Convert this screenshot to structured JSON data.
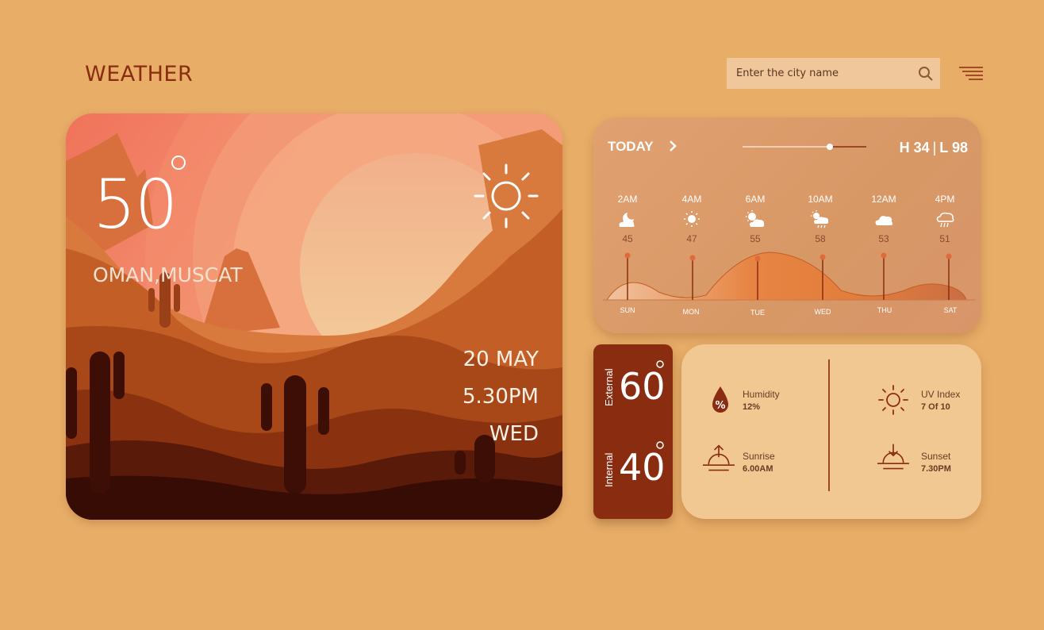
{
  "header": {
    "title": "WEATHER",
    "search_placeholder": "Enter the city name",
    "search_icon": "search-icon",
    "menu_icon": "menu-icon"
  },
  "current": {
    "temperature": "50",
    "location": "OMAN,MUSCAT",
    "date": "20 MAY",
    "time": "5.30PM",
    "day": "WED",
    "condition_icon": "sun-icon"
  },
  "forecast": {
    "today_label": "TODAY",
    "high_label": "H 34",
    "low_label": "L 98",
    "hours": [
      {
        "time": "2AM",
        "temp": "45",
        "icon": "moon-cloud-icon"
      },
      {
        "time": "4AM",
        "temp": "47",
        "icon": "sun-icon"
      },
      {
        "time": "6AM",
        "temp": "55",
        "icon": "partly-cloudy-icon"
      },
      {
        "time": "10AM",
        "temp": "58",
        "icon": "sun-rain-cloud-icon"
      },
      {
        "time": "12AM",
        "temp": "53",
        "icon": "cloud-icon"
      },
      {
        "time": "4PM",
        "temp": "51",
        "icon": "rain-cloud-icon"
      }
    ],
    "days": [
      "SUN",
      "MON",
      "TUE",
      "WED",
      "THU",
      "SAT"
    ]
  },
  "temps": {
    "external_label": "External",
    "external_value": "60",
    "internal_label": "Internal",
    "internal_value": "40"
  },
  "details": {
    "humidity_label": "Humidity",
    "humidity_value": "12%",
    "uv_label": "UV Index",
    "uv_value": "7 Of 10",
    "sunrise_label": "Sunrise",
    "sunrise_value": "6.00AM",
    "sunset_label": "Sunset",
    "sunset_value": "7.30PM"
  },
  "colors": {
    "background": "#e8ae68",
    "accent_dark": "#8a2c10",
    "card_light": "#f2c892"
  }
}
